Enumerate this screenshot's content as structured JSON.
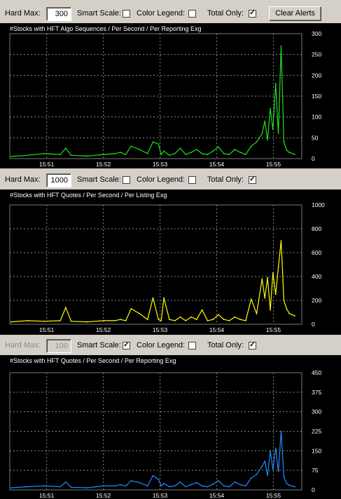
{
  "colors": {
    "chart1": "#22dd22",
    "chart2": "#ffff00",
    "chart3": "#1e8cff",
    "panel_bg": "#000000",
    "grid": "#888888"
  },
  "toolbars": [
    {
      "hard_max_label": "Hard Max:",
      "hard_max_value": "300",
      "hard_max_enabled": true,
      "smart_scale_label": "Smart Scale:",
      "smart_scale_checked": false,
      "color_legend_label": "Color Legend:",
      "color_legend_checked": false,
      "total_only_label": "Total Only:",
      "total_only_checked": true,
      "clear_alerts_label": "Clear Alerts"
    },
    {
      "hard_max_label": "Hard Max:",
      "hard_max_value": "1000",
      "hard_max_enabled": true,
      "smart_scale_label": "Smart Scale:",
      "smart_scale_checked": false,
      "color_legend_label": "Color Legend:",
      "color_legend_checked": false,
      "total_only_label": "Total Only:",
      "total_only_checked": true
    },
    {
      "hard_max_label": "Hard Max:",
      "hard_max_value": "100",
      "hard_max_enabled": false,
      "smart_scale_label": "Smart Scale:",
      "smart_scale_checked": true,
      "color_legend_label": "Color Legend:",
      "color_legend_checked": false,
      "total_only_label": "Total Only:",
      "total_only_checked": true
    }
  ],
  "check_mark": "✓",
  "chart_data": [
    {
      "type": "line",
      "title": "#Stocks with HFT Algo Sequences / Per Second / Per Reporting Exg",
      "ylim": [
        0,
        300
      ],
      "yticks": [
        0,
        50,
        100,
        150,
        200,
        250,
        300
      ],
      "xtick_labels": [
        "15:51",
        "15:52",
        "15:53",
        "15:54",
        "15:55"
      ],
      "x_minutes": [
        0,
        0.3,
        0.6,
        0.9,
        1.0,
        1.1,
        1.4,
        1.7,
        1.9,
        2.0,
        2.1,
        2.2,
        2.35,
        2.5,
        2.6,
        2.7,
        2.75,
        2.8,
        2.9,
        3.0,
        3.1,
        3.2,
        3.3,
        3.4,
        3.5,
        3.6,
        3.7,
        3.8,
        3.9,
        4.0,
        4.1,
        4.2,
        4.3,
        4.4,
        4.5,
        4.6,
        4.65,
        4.7,
        4.75,
        4.8,
        4.85,
        4.9,
        4.95,
        5.0,
        5.05,
        5.1,
        5.2
      ],
      "values": [
        5,
        8,
        12,
        10,
        25,
        8,
        6,
        10,
        12,
        15,
        10,
        30,
        22,
        12,
        40,
        35,
        10,
        18,
        8,
        12,
        25,
        10,
        15,
        22,
        12,
        10,
        18,
        28,
        12,
        10,
        22,
        15,
        10,
        30,
        40,
        60,
        90,
        45,
        120,
        70,
        180,
        60,
        270,
        40,
        20,
        15,
        10
      ]
    },
    {
      "type": "line",
      "title": "#Stocks with HFT Quotes / Per Second / Per Listing Exg",
      "ylim": [
        0,
        1000
      ],
      "yticks": [
        0,
        200,
        400,
        600,
        800,
        1000
      ],
      "xtick_labels": [
        "15:51",
        "15:52",
        "15:53",
        "15:54",
        "15:55"
      ],
      "x_minutes": [
        0,
        0.3,
        0.6,
        0.9,
        1.0,
        1.1,
        1.4,
        1.7,
        1.9,
        2.0,
        2.1,
        2.2,
        2.35,
        2.5,
        2.6,
        2.7,
        2.75,
        2.8,
        2.9,
        3.0,
        3.1,
        3.2,
        3.3,
        3.4,
        3.5,
        3.6,
        3.7,
        3.8,
        3.9,
        4.0,
        4.1,
        4.2,
        4.3,
        4.4,
        4.5,
        4.6,
        4.65,
        4.7,
        4.75,
        4.8,
        4.85,
        4.9,
        4.95,
        5.0,
        5.05,
        5.1,
        5.2
      ],
      "values": [
        20,
        30,
        25,
        30,
        140,
        25,
        20,
        30,
        30,
        40,
        30,
        130,
        90,
        40,
        220,
        40,
        30,
        220,
        40,
        30,
        60,
        30,
        60,
        40,
        120,
        30,
        40,
        80,
        40,
        30,
        60,
        40,
        30,
        210,
        90,
        380,
        220,
        390,
        120,
        430,
        250,
        480,
        700,
        200,
        130,
        90,
        70
      ]
    },
    {
      "type": "line",
      "title": "#Stocks with HFT Quotes / Per Second / Per Reporting Exg",
      "ylim": [
        0,
        450
      ],
      "yticks": [
        0,
        75,
        150,
        225,
        300,
        375,
        450
      ],
      "xtick_labels": [
        "15:51",
        "15:52",
        "15:53",
        "15:54",
        "15:55"
      ],
      "x_minutes": [
        0,
        0.3,
        0.6,
        0.9,
        1.0,
        1.1,
        1.4,
        1.7,
        1.9,
        2.0,
        2.1,
        2.2,
        2.35,
        2.5,
        2.6,
        2.7,
        2.75,
        2.8,
        2.9,
        3.0,
        3.1,
        3.2,
        3.3,
        3.4,
        3.5,
        3.6,
        3.7,
        3.8,
        3.9,
        4.0,
        4.1,
        4.2,
        4.3,
        4.4,
        4.5,
        4.6,
        4.65,
        4.7,
        4.75,
        4.8,
        4.85,
        4.9,
        4.95,
        5.0,
        5.05,
        5.1,
        5.2
      ],
      "values": [
        8,
        12,
        15,
        12,
        30,
        10,
        8,
        15,
        15,
        20,
        15,
        35,
        28,
        15,
        55,
        40,
        15,
        25,
        12,
        15,
        30,
        12,
        20,
        28,
        15,
        12,
        22,
        35,
        15,
        12,
        30,
        20,
        15,
        45,
        60,
        90,
        110,
        55,
        150,
        80,
        160,
        70,
        225,
        50,
        25,
        18,
        12
      ]
    }
  ]
}
